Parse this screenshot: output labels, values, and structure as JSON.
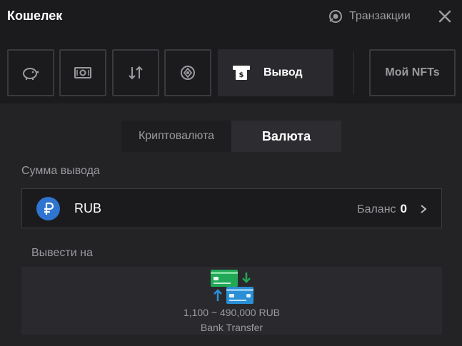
{
  "header": {
    "title": "Кошелек",
    "transactions_label": "Транзакции"
  },
  "tabs": {
    "icons": [
      "piggy-bank-icon",
      "banknote-icon",
      "swap-arrows-icon",
      "crypto-chip-icon"
    ],
    "active_label": "Вывод",
    "nft_label": "Мой NFTs"
  },
  "segment": {
    "crypto_label": "Криптовалюта",
    "fiat_label": "Валюта"
  },
  "amount": {
    "label": "Сумма вывода",
    "currency_code": "RUB",
    "balance_label": "Баланс",
    "balance_value": "0"
  },
  "withdraw_to": {
    "label": "Вывести на",
    "method_range": "1,100 ~ 490,000 RUB",
    "method_name": "Bank Transfer"
  },
  "colors": {
    "accent_blue": "#2f74d0",
    "card_green": "#21a957",
    "card_blue": "#2a8fd6"
  }
}
